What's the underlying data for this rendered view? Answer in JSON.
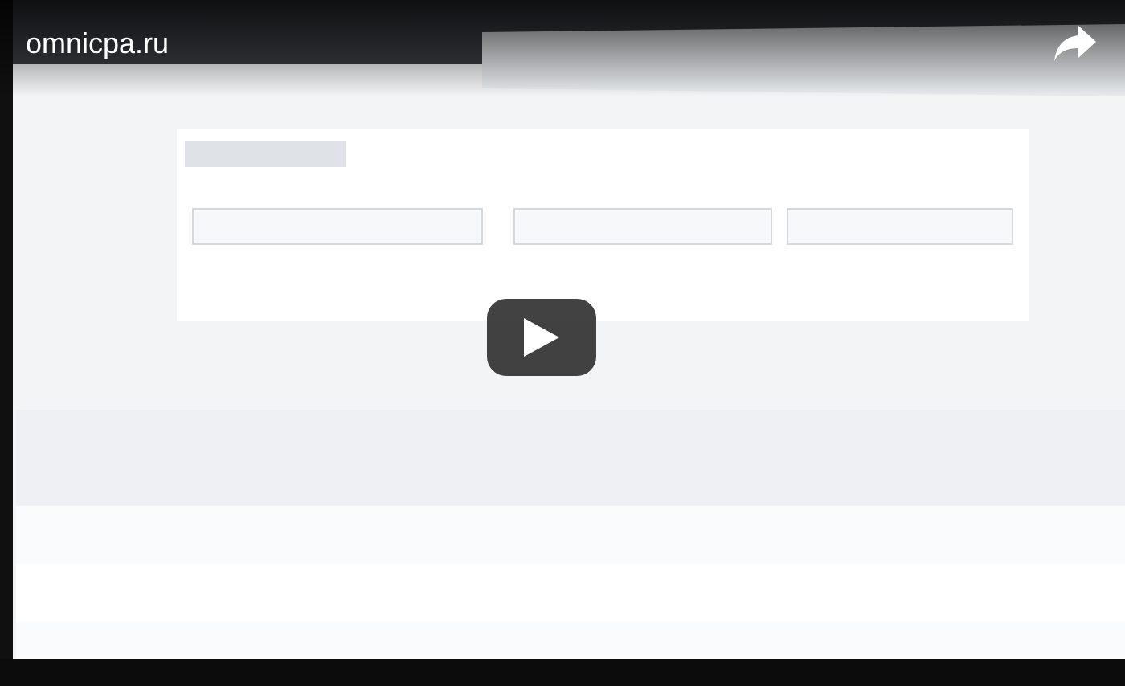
{
  "player": {
    "title": "omnicpa.ru"
  }
}
